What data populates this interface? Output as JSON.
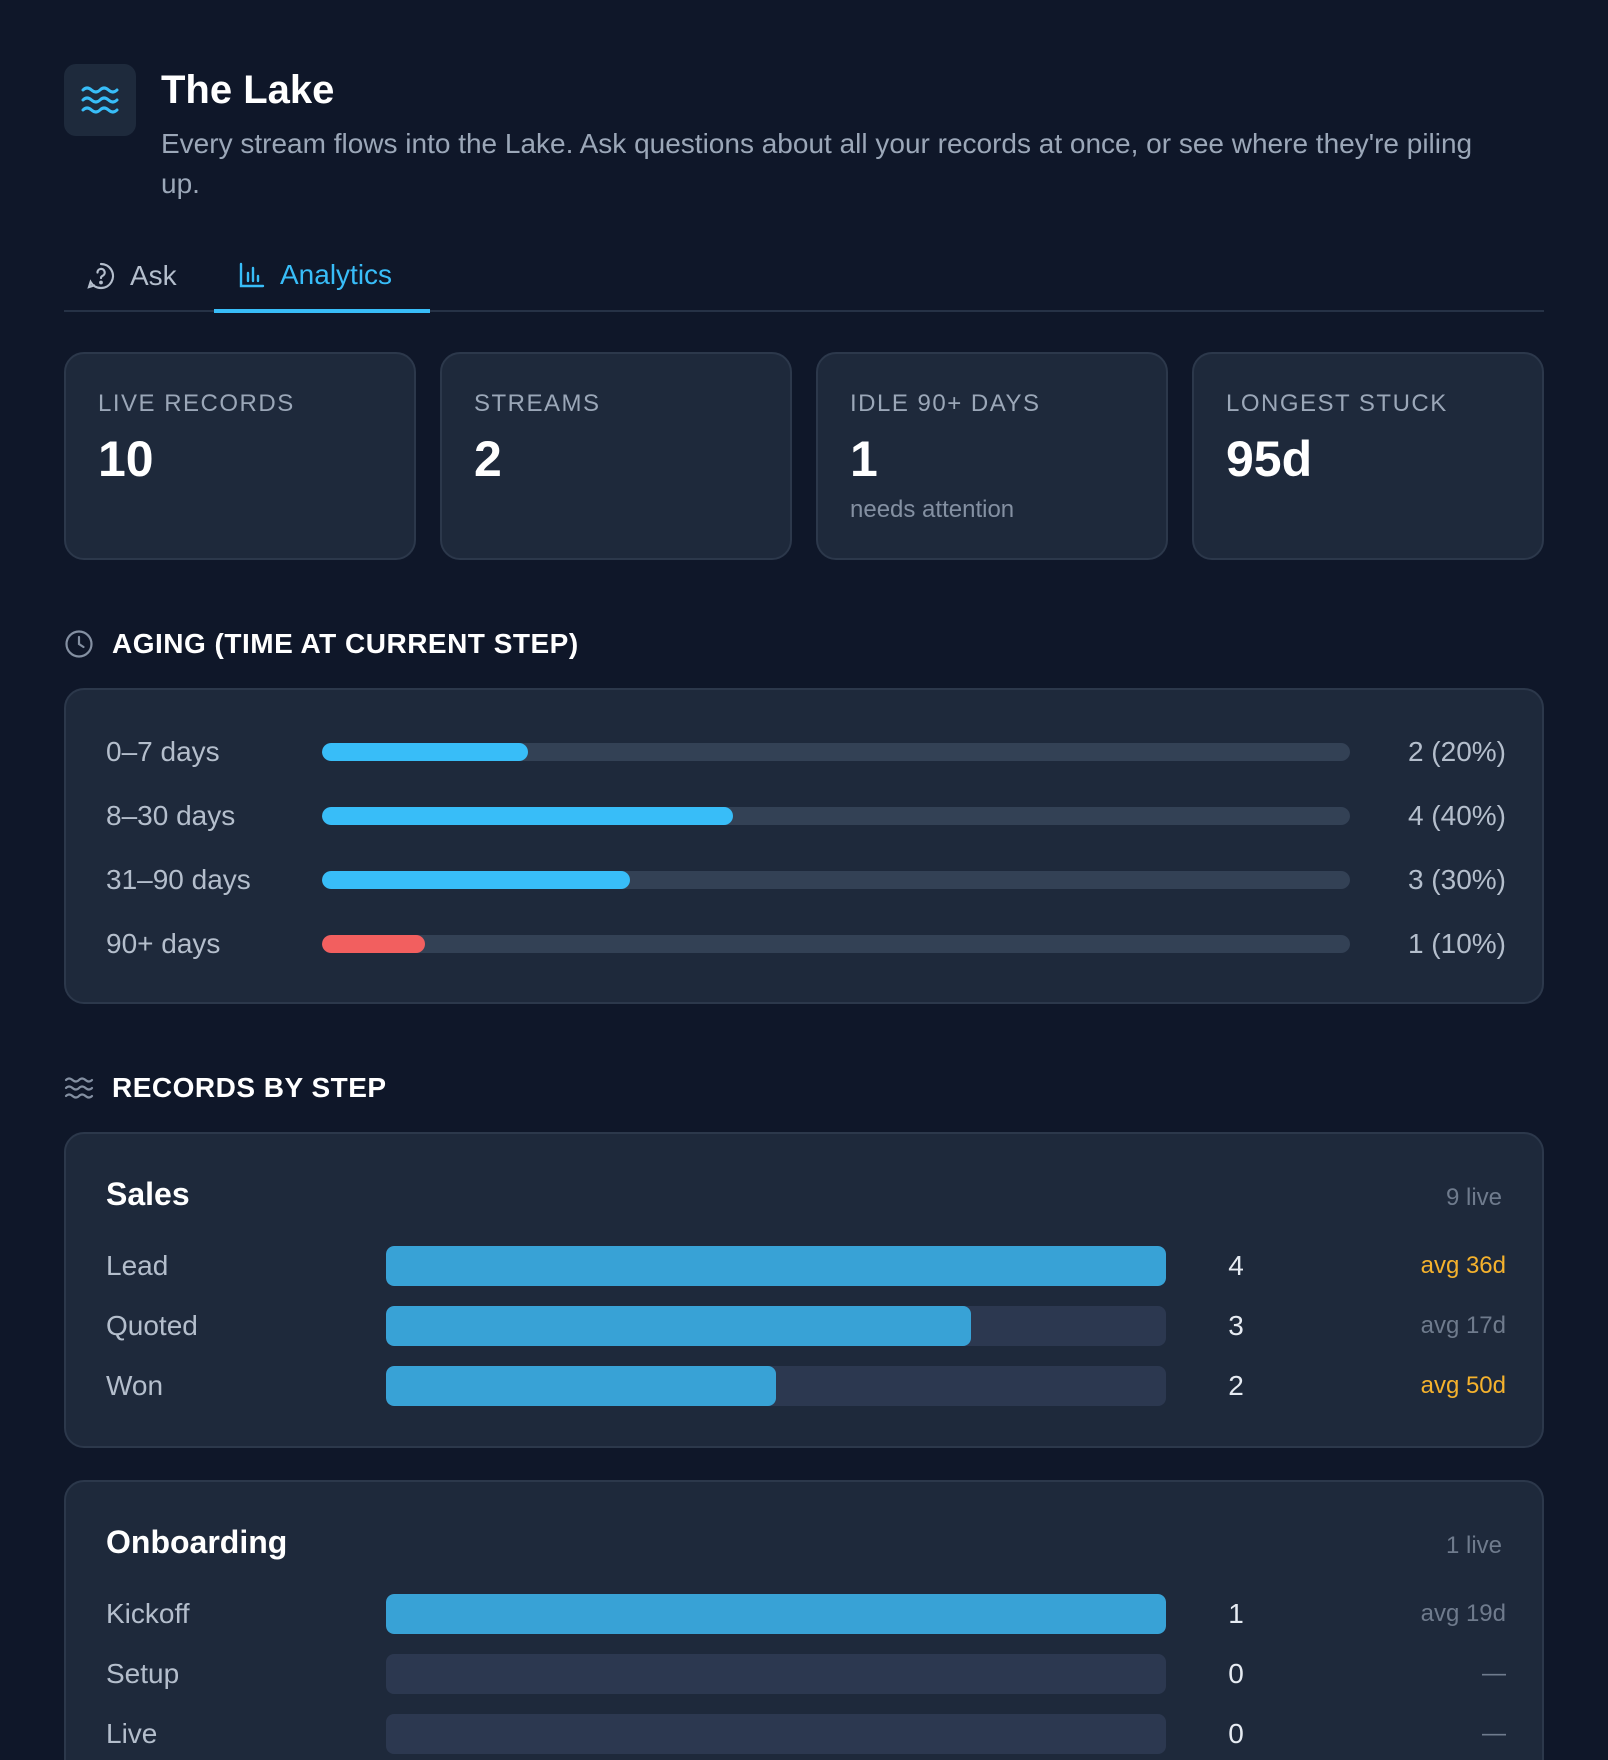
{
  "header": {
    "title": "The Lake",
    "subtitle": "Every stream flows into the Lake. Ask questions about all your records at once, or see where they're piling up.",
    "logo_icon": "waves-icon"
  },
  "tabs": [
    {
      "label": "Ask",
      "icon": "question-circle-icon",
      "active": false
    },
    {
      "label": "Analytics",
      "icon": "bar-chart-icon",
      "active": true
    }
  ],
  "stats": [
    {
      "label": "LIVE RECORDS",
      "value": "10",
      "sub": ""
    },
    {
      "label": "STREAMS",
      "value": "2",
      "sub": ""
    },
    {
      "label": "IDLE 90+ DAYS",
      "value": "1",
      "sub": "needs attention"
    },
    {
      "label": "LONGEST STUCK",
      "value": "95d",
      "sub": ""
    }
  ],
  "aging": {
    "title": "AGING (TIME AT CURRENT STEP)",
    "icon": "clock-icon",
    "rows": [
      {
        "label": "0–7 days",
        "count": "2 (20%)",
        "fraction": 0.2,
        "color": "#38bdf8"
      },
      {
        "label": "8–30 days",
        "count": "4 (40%)",
        "fraction": 0.4,
        "color": "#38bdf8"
      },
      {
        "label": "31–90 days",
        "count": "3 (30%)",
        "fraction": 0.3,
        "color": "#38bdf8"
      },
      {
        "label": "90+ days",
        "count": "1 (10%)",
        "fraction": 0.1,
        "color": "#f25f5f"
      }
    ]
  },
  "records_by_step": {
    "title": "RECORDS BY STEP",
    "icon": "waves-icon",
    "streams": [
      {
        "name": "Sales",
        "live": "9 live",
        "steps": [
          {
            "label": "Lead",
            "count": "4",
            "fraction": 1.0,
            "avg": "avg 36d",
            "warn": true
          },
          {
            "label": "Quoted",
            "count": "3",
            "fraction": 0.75,
            "avg": "avg 17d",
            "warn": false
          },
          {
            "label": "Won",
            "count": "2",
            "fraction": 0.5,
            "avg": "avg 50d",
            "warn": true
          }
        ]
      },
      {
        "name": "Onboarding",
        "live": "1 live",
        "steps": [
          {
            "label": "Kickoff",
            "count": "1",
            "fraction": 1.0,
            "avg": "avg 19d",
            "warn": false
          },
          {
            "label": "Setup",
            "count": "0",
            "fraction": 0,
            "avg": "—",
            "warn": false
          },
          {
            "label": "Live",
            "count": "0",
            "fraction": 0,
            "avg": "—",
            "warn": false
          }
        ]
      }
    ]
  },
  "colors": {
    "accent": "#38bdf8",
    "danger": "#f25f5f",
    "warning": "#f5b22d",
    "background": "#0f1729",
    "card": "#1e293b"
  }
}
